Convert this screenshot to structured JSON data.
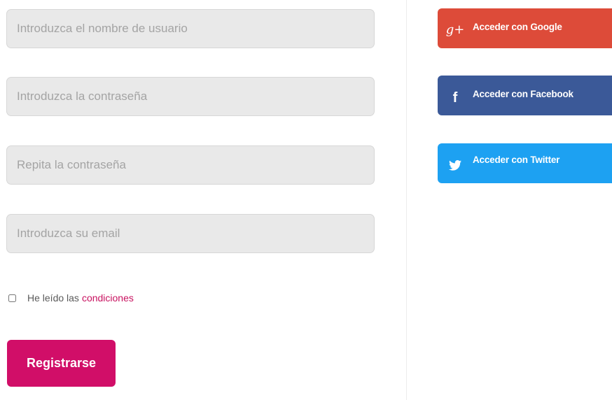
{
  "form": {
    "username_placeholder": "Introduzca el nombre de usuario",
    "password_placeholder": "Introduzca la contraseña",
    "password_repeat_placeholder": "Repita la contraseña",
    "email_placeholder": "Introduzca su email",
    "terms_text": "He leído las",
    "terms_link": "condiciones",
    "register_label": "Registrarse"
  },
  "social": {
    "google_label": "Acceder con Google",
    "google_icon": "g+",
    "facebook_label": "Acceder con Facebook",
    "facebook_icon": "f",
    "twitter_label": "Acceder con Twitter"
  },
  "colors": {
    "accent": "#d10e68",
    "google": "#dd4b39",
    "facebook": "#3b5998",
    "twitter": "#1da1f2"
  }
}
